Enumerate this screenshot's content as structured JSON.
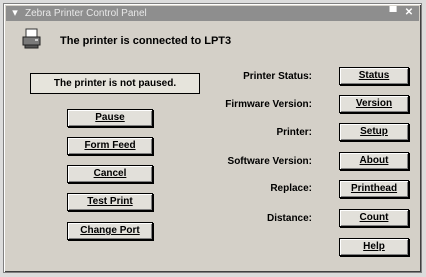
{
  "window": {
    "title": "Zebra Printer Control Panel"
  },
  "header": {
    "connection_text": "The printer is connected to LPT3"
  },
  "status": {
    "text": "The printer is not paused."
  },
  "left_buttons": [
    {
      "label": "Pause"
    },
    {
      "label": "Form Feed"
    },
    {
      "label": "Cancel"
    },
    {
      "label": "Test Print"
    },
    {
      "label": "Change Port"
    }
  ],
  "rows": [
    {
      "label": "Printer Status:",
      "button": "Status"
    },
    {
      "label": "Firmware Version:",
      "button": "Version"
    },
    {
      "label": "Printer:",
      "button": "Setup"
    },
    {
      "label": "Software Version:",
      "button": "About"
    },
    {
      "label": "Replace:",
      "button": "Printhead"
    },
    {
      "label": "Distance:",
      "button": "Count"
    },
    {
      "label": "",
      "button": "Help"
    }
  ],
  "colors": {
    "titlebar": "#8e8e8e",
    "face": "#d4d0c8"
  },
  "icons": {
    "app": "printer-icon",
    "window_menu": "window-menu-icon"
  }
}
